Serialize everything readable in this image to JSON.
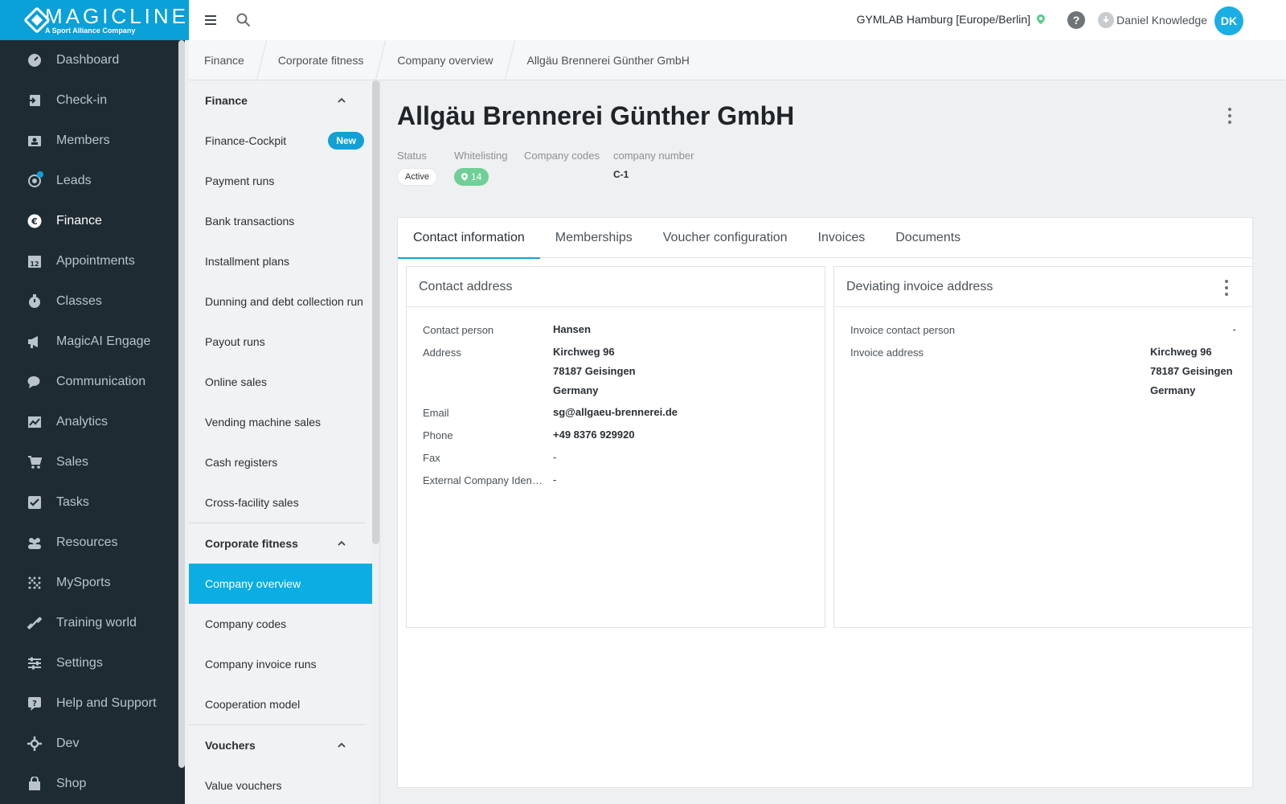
{
  "brand": {
    "name": "MAGICLINE",
    "tagline": "A Sport Alliance Company"
  },
  "topbar": {
    "studio": "GYMLAB Hamburg [Europe/Berlin]",
    "help": "?",
    "username": "Daniel Knowledge",
    "avatar_initials": "DK"
  },
  "nav": [
    {
      "label": "Dashboard",
      "icon": "dashboard-icon"
    },
    {
      "label": "Check-in",
      "icon": "check-in-icon"
    },
    {
      "label": "Members",
      "icon": "members-icon"
    },
    {
      "label": "Leads",
      "icon": "leads-icon"
    },
    {
      "label": "Finance",
      "icon": "euro-icon"
    },
    {
      "label": "Appointments",
      "icon": "calendar-icon"
    },
    {
      "label": "Classes",
      "icon": "stopwatch-icon"
    },
    {
      "label": "MagicAI Engage",
      "icon": "megaphone-icon"
    },
    {
      "label": "Communication",
      "icon": "chat-icon"
    },
    {
      "label": "Analytics",
      "icon": "chart-icon"
    },
    {
      "label": "Sales",
      "icon": "cart-icon"
    },
    {
      "label": "Tasks",
      "icon": "checkbox-icon"
    },
    {
      "label": "Resources",
      "icon": "people-icon"
    },
    {
      "label": "MySports",
      "icon": "grid-dots-icon"
    },
    {
      "label": "Training world",
      "icon": "dumbbell-icon"
    },
    {
      "label": "Settings",
      "icon": "sliders-icon"
    },
    {
      "label": "Help and Support",
      "icon": "help-icon"
    },
    {
      "label": "Dev",
      "icon": "dev-icon"
    },
    {
      "label": "Shop",
      "icon": "shop-icon"
    }
  ],
  "breadcrumb": [
    "Finance",
    "Corporate fitness",
    "Company overview",
    "Allgäu Brennerei Günther GmbH"
  ],
  "submenu": {
    "finance_title": "Finance",
    "finance_items": [
      "Finance-Cockpit",
      "Payment runs",
      "Bank transactions",
      "Installment plans",
      "Dunning and debt collection run",
      "Payout runs",
      "Online sales",
      "Vending machine sales",
      "Cash registers",
      "Cross-facility sales"
    ],
    "new_badge": "New",
    "corporate_title": "Corporate fitness",
    "corporate_items": [
      "Company overview",
      "Company codes",
      "Company invoice runs",
      "Cooperation model"
    ],
    "vouchers_title": "Vouchers",
    "vouchers_items": [
      "Value vouchers"
    ]
  },
  "company": {
    "title": "Allgäu Brennerei Günther GmbH",
    "status_label": "Status",
    "status_value": "Active",
    "whitelisting_label": "Whitelisting",
    "whitelisting_value": "14",
    "codes_label": "Company codes",
    "number_label": "company number",
    "number_value": "C-1"
  },
  "tabs": [
    "Contact information",
    "Memberships",
    "Voucher configuration",
    "Invoices",
    "Documents"
  ],
  "contact": {
    "title": "Contact address",
    "person_label": "Contact person",
    "person_value": "Hansen",
    "address_label": "Address",
    "address_lines": [
      "Kirchweg 96",
      "78187 Geisingen",
      "Germany"
    ],
    "email_label": "Email",
    "email_value": "sg@allgaeu-brennerei.de",
    "phone_label": "Phone",
    "phone_value": "+49 8376 929920",
    "fax_label": "Fax",
    "fax_value": "-",
    "ext_label": "External Company Iden…",
    "ext_value": "-"
  },
  "invoice": {
    "title": "Deviating invoice address",
    "person_label": "Invoice contact person",
    "person_value": "-",
    "address_label": "Invoice address",
    "address_lines": [
      "Kirchweg 96",
      "78187 Geisingen",
      "Germany"
    ]
  },
  "colors": {
    "brand": "#0aa0d8",
    "sidebar": "#1f2b33",
    "active_item": "#0aaee3",
    "whitelist_chip": "#6fcf97"
  }
}
